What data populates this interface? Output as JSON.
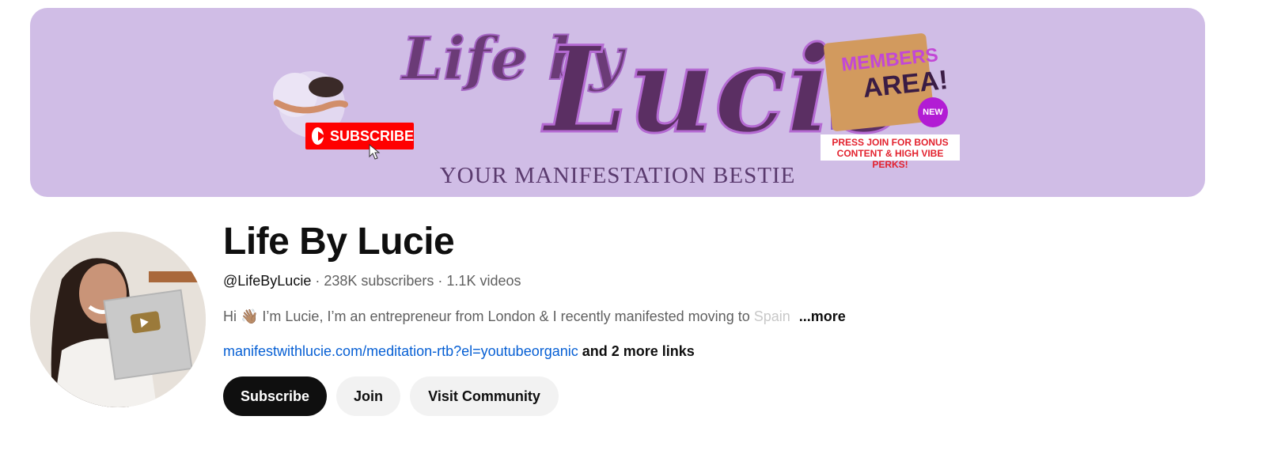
{
  "banner": {
    "title_part1": "Life by",
    "title_part2": "Lucie",
    "tagline": "YOUR MANIFESTATION BESTIE",
    "subscribe_graphic_label": "SUBSCRIBE",
    "members_line1": "MEMBERS",
    "members_line2": "AREA!",
    "new_badge": "NEW",
    "press_join_line1": "PRESS JOIN FOR BONUS",
    "press_join_line2": "CONTENT & HIGH VIBE PERKS!"
  },
  "channel": {
    "name": "Life By Lucie",
    "handle": "@LifeByLucie",
    "separator": " · ",
    "subscribers": "238K subscribers",
    "videos": "1.1K videos",
    "description": "Hi 👋🏽 I’m Lucie, I’m an entrepreneur from London & I recently manifested moving to ",
    "description_faded": "Spain",
    "more_label": "...more",
    "link_url": "manifestwithlucie.com/meditation-rtb?el=youtubeorganic",
    "more_links": "and 2 more links"
  },
  "actions": {
    "subscribe": "Subscribe",
    "join": "Join",
    "visit_community": "Visit Community"
  },
  "colors": {
    "banner_bg": "#d0bde6",
    "subscribe_bg": "#0f0f0f",
    "link": "#065fd4",
    "youtube_red": "#ff0000"
  }
}
